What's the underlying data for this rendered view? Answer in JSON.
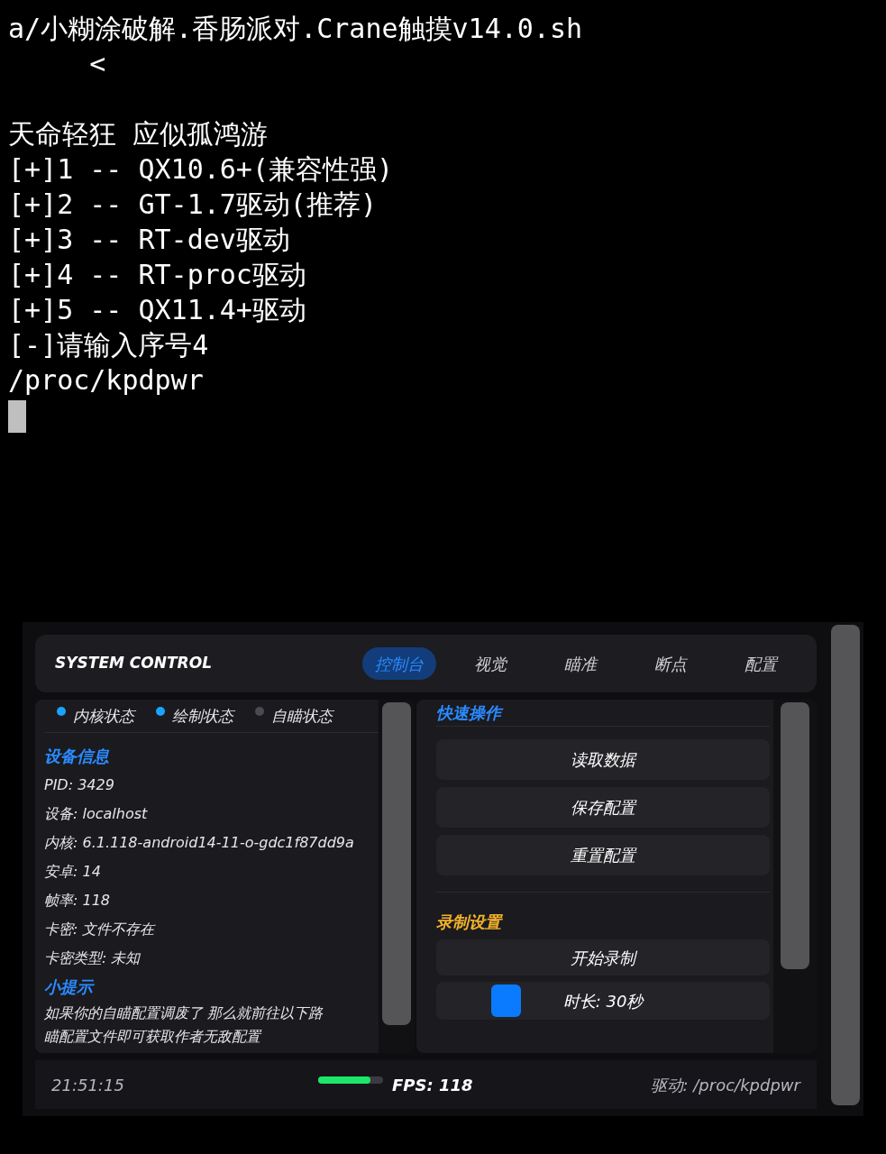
{
  "terminal": {
    "header_lines": [
      "a/小糊涂破解.香肠派对.Crane触摸v14.0.sh",
      "     <"
    ],
    "lines": [
      "天命轻狂 应似孤鸿游",
      "[+]1 -- QX10.6+(兼容性强)",
      "[+]2 -- GT-1.7驱动(推荐)",
      "[+]3 -- RT-dev驱动",
      "[+]4 -- RT-proc驱动",
      "[+]5 -- QX11.4+驱动",
      "[-]请输入序号4",
      "/proc/kpdpwr"
    ]
  },
  "panel": {
    "title": "SYSTEM CONTROL",
    "tabs": [
      {
        "label": "控制台",
        "selected": true
      },
      {
        "label": "视觉",
        "selected": false
      },
      {
        "label": "瞄准",
        "selected": false
      },
      {
        "label": "断点",
        "selected": false
      },
      {
        "label": "配置",
        "selected": false
      }
    ],
    "statuses": [
      {
        "label": "内核状态",
        "on": true
      },
      {
        "label": "绘制状态",
        "on": true
      },
      {
        "label": "自瞄状态",
        "on": false
      }
    ],
    "device_heading": "设备信息",
    "device_lines": [
      "PID: 3429",
      "设备: localhost",
      "内核: 6.1.118-android14-11-o-gdc1f87dd9a",
      "安卓: 14",
      "帧率: 118",
      "卡密: 文件不存在",
      "卡密类型: 未知"
    ],
    "tip_heading": "小提示",
    "tip_lines": [
      "如果你的自瞄配置调废了 那么就前往以下路",
      "瞄配置文件即可获取作者无敌配置"
    ],
    "quick_heading": "快速操作",
    "quick_buttons": [
      "读取数据",
      "保存配置",
      "重置配置"
    ],
    "record_heading": "录制设置",
    "record_button": "开始录制",
    "duration": {
      "label": "时长: 30秒",
      "level": 0.18
    },
    "status_bar": {
      "time": "21:51:15",
      "fps_meter": {
        "level": 0.8
      },
      "fps": "FPS: 118",
      "driver": "驱动: /proc/kpdpwr"
    }
  }
}
